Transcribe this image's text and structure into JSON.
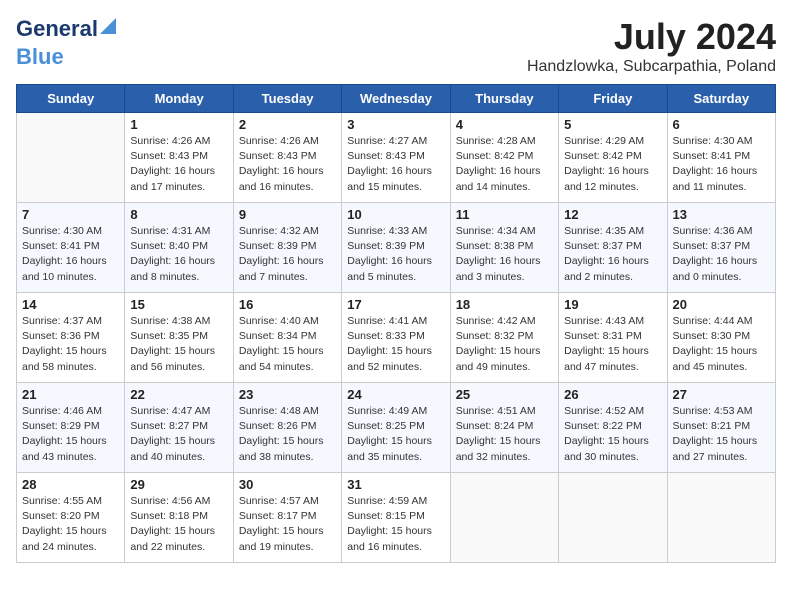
{
  "logo": {
    "line1": "General",
    "line2": "Blue"
  },
  "title": {
    "month_year": "July 2024",
    "location": "Handzlowka, Subcarpathia, Poland"
  },
  "headers": [
    "Sunday",
    "Monday",
    "Tuesday",
    "Wednesday",
    "Thursday",
    "Friday",
    "Saturday"
  ],
  "weeks": [
    [
      {
        "day": "",
        "info": ""
      },
      {
        "day": "1",
        "info": "Sunrise: 4:26 AM\nSunset: 8:43 PM\nDaylight: 16 hours\nand 17 minutes."
      },
      {
        "day": "2",
        "info": "Sunrise: 4:26 AM\nSunset: 8:43 PM\nDaylight: 16 hours\nand 16 minutes."
      },
      {
        "day": "3",
        "info": "Sunrise: 4:27 AM\nSunset: 8:43 PM\nDaylight: 16 hours\nand 15 minutes."
      },
      {
        "day": "4",
        "info": "Sunrise: 4:28 AM\nSunset: 8:42 PM\nDaylight: 16 hours\nand 14 minutes."
      },
      {
        "day": "5",
        "info": "Sunrise: 4:29 AM\nSunset: 8:42 PM\nDaylight: 16 hours\nand 12 minutes."
      },
      {
        "day": "6",
        "info": "Sunrise: 4:30 AM\nSunset: 8:41 PM\nDaylight: 16 hours\nand 11 minutes."
      }
    ],
    [
      {
        "day": "7",
        "info": "Sunrise: 4:30 AM\nSunset: 8:41 PM\nDaylight: 16 hours\nand 10 minutes."
      },
      {
        "day": "8",
        "info": "Sunrise: 4:31 AM\nSunset: 8:40 PM\nDaylight: 16 hours\nand 8 minutes."
      },
      {
        "day": "9",
        "info": "Sunrise: 4:32 AM\nSunset: 8:39 PM\nDaylight: 16 hours\nand 7 minutes."
      },
      {
        "day": "10",
        "info": "Sunrise: 4:33 AM\nSunset: 8:39 PM\nDaylight: 16 hours\nand 5 minutes."
      },
      {
        "day": "11",
        "info": "Sunrise: 4:34 AM\nSunset: 8:38 PM\nDaylight: 16 hours\nand 3 minutes."
      },
      {
        "day": "12",
        "info": "Sunrise: 4:35 AM\nSunset: 8:37 PM\nDaylight: 16 hours\nand 2 minutes."
      },
      {
        "day": "13",
        "info": "Sunrise: 4:36 AM\nSunset: 8:37 PM\nDaylight: 16 hours\nand 0 minutes."
      }
    ],
    [
      {
        "day": "14",
        "info": "Sunrise: 4:37 AM\nSunset: 8:36 PM\nDaylight: 15 hours\nand 58 minutes."
      },
      {
        "day": "15",
        "info": "Sunrise: 4:38 AM\nSunset: 8:35 PM\nDaylight: 15 hours\nand 56 minutes."
      },
      {
        "day": "16",
        "info": "Sunrise: 4:40 AM\nSunset: 8:34 PM\nDaylight: 15 hours\nand 54 minutes."
      },
      {
        "day": "17",
        "info": "Sunrise: 4:41 AM\nSunset: 8:33 PM\nDaylight: 15 hours\nand 52 minutes."
      },
      {
        "day": "18",
        "info": "Sunrise: 4:42 AM\nSunset: 8:32 PM\nDaylight: 15 hours\nand 49 minutes."
      },
      {
        "day": "19",
        "info": "Sunrise: 4:43 AM\nSunset: 8:31 PM\nDaylight: 15 hours\nand 47 minutes."
      },
      {
        "day": "20",
        "info": "Sunrise: 4:44 AM\nSunset: 8:30 PM\nDaylight: 15 hours\nand 45 minutes."
      }
    ],
    [
      {
        "day": "21",
        "info": "Sunrise: 4:46 AM\nSunset: 8:29 PM\nDaylight: 15 hours\nand 43 minutes."
      },
      {
        "day": "22",
        "info": "Sunrise: 4:47 AM\nSunset: 8:27 PM\nDaylight: 15 hours\nand 40 minutes."
      },
      {
        "day": "23",
        "info": "Sunrise: 4:48 AM\nSunset: 8:26 PM\nDaylight: 15 hours\nand 38 minutes."
      },
      {
        "day": "24",
        "info": "Sunrise: 4:49 AM\nSunset: 8:25 PM\nDaylight: 15 hours\nand 35 minutes."
      },
      {
        "day": "25",
        "info": "Sunrise: 4:51 AM\nSunset: 8:24 PM\nDaylight: 15 hours\nand 32 minutes."
      },
      {
        "day": "26",
        "info": "Sunrise: 4:52 AM\nSunset: 8:22 PM\nDaylight: 15 hours\nand 30 minutes."
      },
      {
        "day": "27",
        "info": "Sunrise: 4:53 AM\nSunset: 8:21 PM\nDaylight: 15 hours\nand 27 minutes."
      }
    ],
    [
      {
        "day": "28",
        "info": "Sunrise: 4:55 AM\nSunset: 8:20 PM\nDaylight: 15 hours\nand 24 minutes."
      },
      {
        "day": "29",
        "info": "Sunrise: 4:56 AM\nSunset: 8:18 PM\nDaylight: 15 hours\nand 22 minutes."
      },
      {
        "day": "30",
        "info": "Sunrise: 4:57 AM\nSunset: 8:17 PM\nDaylight: 15 hours\nand 19 minutes."
      },
      {
        "day": "31",
        "info": "Sunrise: 4:59 AM\nSunset: 8:15 PM\nDaylight: 15 hours\nand 16 minutes."
      },
      {
        "day": "",
        "info": ""
      },
      {
        "day": "",
        "info": ""
      },
      {
        "day": "",
        "info": ""
      }
    ]
  ]
}
